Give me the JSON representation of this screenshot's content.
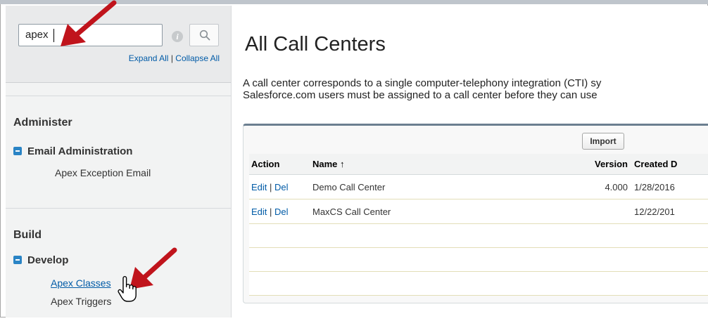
{
  "sidebar": {
    "search": {
      "value": "apex",
      "placeholder": ""
    },
    "expand_all": "Expand All",
    "separator": "|",
    "collapse_all": "Collapse All",
    "sections": [
      {
        "title": "Administer",
        "group": "Email Administration",
        "items": [
          "Apex Exception Email"
        ]
      },
      {
        "title": "Build",
        "group": "Develop",
        "items": [
          "Apex Classes",
          "Apex Triggers"
        ]
      }
    ]
  },
  "main": {
    "title": "All Call Centers",
    "description": [
      "A call center corresponds to a single computer-telephony integration (CTI) sy",
      "Salesforce.com users must be assigned to a call center before they can use"
    ],
    "import_label": "Import",
    "columns": [
      "Action",
      "Name ↑",
      "Version",
      "Created D"
    ],
    "rows": [
      {
        "edit": "Edit",
        "sep": "|",
        "del": "Del",
        "name": "Demo Call Center",
        "version": "4.000",
        "created": "1/28/2016"
      },
      {
        "edit": "Edit",
        "sep": "|",
        "del": "Del",
        "name": "MaxCS Call Center",
        "version": "",
        "created": "12/22/201"
      }
    ]
  },
  "colors": {
    "link": "#015ba7",
    "arrow": "#c0141c",
    "toggle": "#2a84c5",
    "header_bar": "#6b7f90"
  },
  "icons": [
    "info-icon",
    "search-icon",
    "expand-toggle-icon",
    "hand-cursor-icon",
    "annotation-arrow"
  ]
}
